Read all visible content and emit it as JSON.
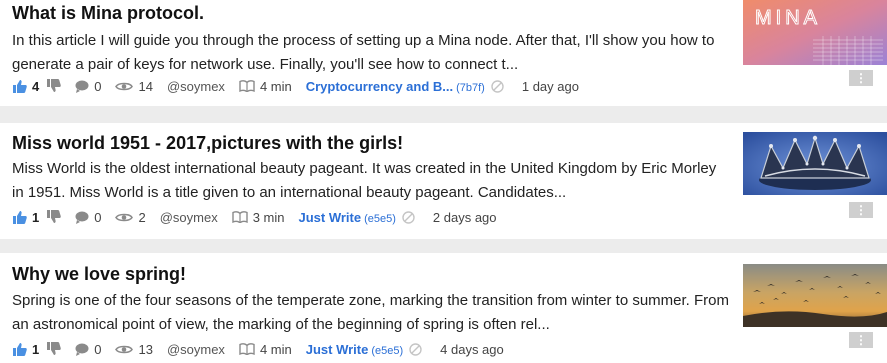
{
  "posts": [
    {
      "title": "What is Mina protocol.",
      "excerpt": "In this article I will guide you through the process of setting up a Mina node. After that, I'll show you how to generate a pair of keys for network use. Finally, you'll see how to connect t...",
      "likes": "4",
      "comments": "0",
      "views": "14",
      "author": "@soymex",
      "read_time": "4 min",
      "category": "Cryptocurrency and B...",
      "category_code": "(7b7f)",
      "age": "1 day ago",
      "thumb_text": "MINA"
    },
    {
      "title": "Miss world 1951 - 2017,pictures with the girls!",
      "excerpt": "Miss World is the oldest international beauty pageant. It was created in the United Kingdom by Eric Morley in 1951. Miss World is a title given to an international beauty pageant. Candidates...",
      "likes": "1",
      "comments": "0",
      "views": "2",
      "author": "@soymex",
      "read_time": "3 min",
      "category": "Just Write",
      "category_code": "(e5e5)",
      "age": "2 days ago"
    },
    {
      "title": "Why we love spring!",
      "excerpt": "Spring is one of the four seasons of the temperate zone, marking the transition from winter to summer. From an astronomical point of view, the marking of the beginning of spring is often rel...",
      "likes": "1",
      "comments": "0",
      "views": "13",
      "author": "@soymex",
      "read_time": "4 min",
      "category": "Just Write",
      "category_code": "(e5e5)",
      "age": "4 days ago"
    }
  ],
  "menu_glyph": "⋮",
  "colors": {
    "accent": "#2b6fd6",
    "like": "#4a90e2",
    "muted": "#8a8a8a"
  }
}
